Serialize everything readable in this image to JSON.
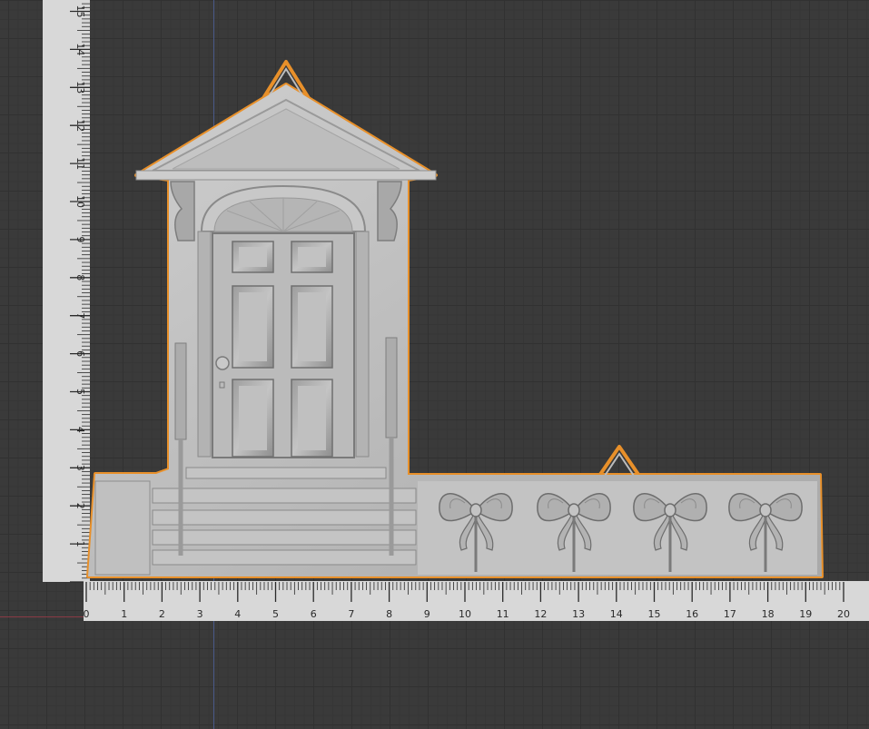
{
  "viewport": {
    "background": "#3a3a3a",
    "grid_color": "#313131",
    "x_axis_color": "#8a3a44",
    "y_axis_color": "#4a5a8a"
  },
  "horizontal_ruler": {
    "labels": [
      "0",
      "1",
      "2",
      "3",
      "4",
      "5",
      "6",
      "7",
      "8",
      "9",
      "10",
      "11",
      "12",
      "13",
      "14",
      "15",
      "16",
      "17",
      "18",
      "19",
      "20"
    ],
    "color": "#d8d8d8"
  },
  "vertical_ruler": {
    "labels": [
      "1",
      "2",
      "3",
      "4",
      "5",
      "6",
      "7",
      "8",
      "9",
      "10",
      "11",
      "12",
      "13",
      "14",
      "15"
    ],
    "color": "#d8d8d8"
  },
  "model": {
    "icon": "door-facade-model-icon",
    "selection_outline_color": "#e8902a",
    "surface_color": "#b9b9b9",
    "ornaments": [
      "bow-icon",
      "bow-icon",
      "bow-icon",
      "bow-icon"
    ]
  }
}
